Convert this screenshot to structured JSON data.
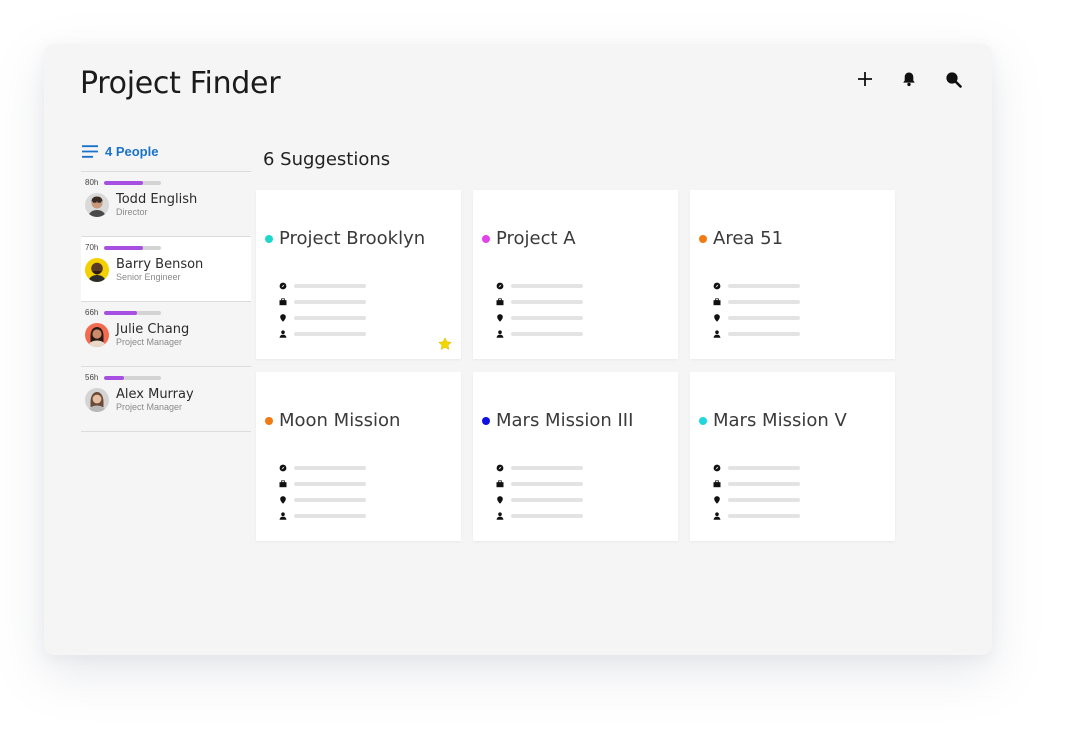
{
  "app": {
    "title": "Project Finder"
  },
  "toolbar": {
    "icons": [
      "plus-icon",
      "bell-icon",
      "search-icon"
    ]
  },
  "people": {
    "header_label": "4 People",
    "list": [
      {
        "hours": "80h",
        "utilization": 0.68,
        "name": "Todd English",
        "role": "Director",
        "avatar_bg": "#d9d9d9",
        "selected": false
      },
      {
        "hours": "70h",
        "utilization": 0.68,
        "name": "Barry Benson",
        "role": "Senior Engineer",
        "avatar_bg": "#f5d000",
        "selected": true
      },
      {
        "hours": "66h",
        "utilization": 0.58,
        "name": "Julie Chang",
        "role": "Project Manager",
        "avatar_bg": "#f26b4f",
        "selected": false
      },
      {
        "hours": "56h",
        "utilization": 0.35,
        "name": "Alex Murray",
        "role": "Project Manager",
        "avatar_bg": "#d4d4d4",
        "selected": false
      }
    ]
  },
  "suggestions": {
    "title": "6 Suggestions",
    "cards": [
      {
        "name": "Project Brooklyn",
        "color": "#1fd6cc",
        "starred": true
      },
      {
        "name": "Project A",
        "color": "#e044e8",
        "starred": false
      },
      {
        "name": "Area 51",
        "color": "#f27a12",
        "starred": false
      },
      {
        "name": "Moon Mission",
        "color": "#f27a12",
        "starred": false
      },
      {
        "name": "Mars Mission III",
        "color": "#1010e0",
        "starred": false
      },
      {
        "name": "Mars Mission V",
        "color": "#1fd6dc",
        "starred": false
      }
    ],
    "meta_icons": [
      "compass-icon",
      "briefcase-icon",
      "location-pin-icon",
      "person-icon"
    ]
  },
  "colors": {
    "accent": "#1a73c8",
    "utilization_bar": "#a64fe0",
    "star": "#f2d600"
  }
}
